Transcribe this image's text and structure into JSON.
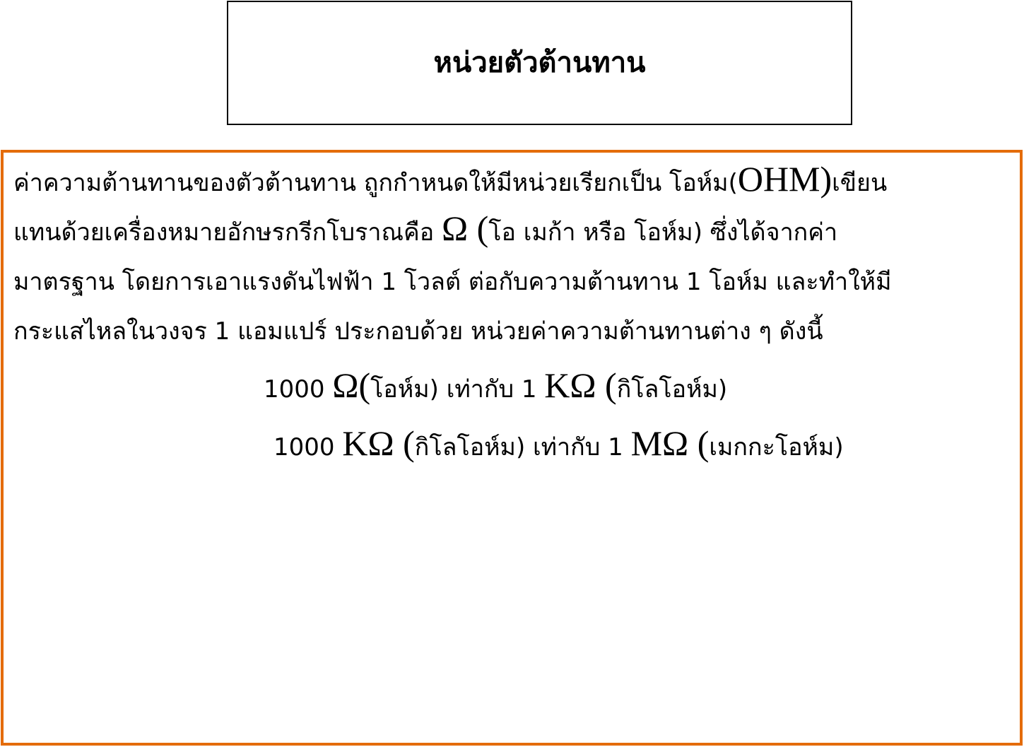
{
  "title": "หน่วยตัวต้านทาน",
  "colors": {
    "content_border": "#E46C0A",
    "title_border": "#000000"
  },
  "paragraph": {
    "l1_text": "ค่าความต้านทานของตัวต้านทาน ถูกกำหนดให้มีหน่วยเรียกเป็น โอห์ม(",
    "l1_sym": "OHM)",
    "l1_end": "เขียน",
    "l2_start": "แทนด้วยเครื่องหมายอักษรกรีกโบราณคือ ",
    "l2_sym": "Ω (",
    "l2_end": "โอ เมก้า หรือ โอห์ม) ซึ่งได้จากค่า",
    "l3": "มาตรฐาน โดยการเอาแรงดันไฟฟ้า 1 โวลต์ ต่อกับความต้านทาน 1 โอห์ม และทำให้มี",
    "l4": "กระแสไหลในวงจร 1 แอมแปร์ ประกอบด้วย หน่วยค่าความต้านทานต่าง ๆ ดังนี้"
  },
  "equations": [
    {
      "left_value": "1000  ",
      "left_unit": "Ω(",
      "left_name": "โอห์ม) เท่ากับ 1 ",
      "right_unit": "KΩ (",
      "right_name": "กิโลโอห์ม)"
    },
    {
      "left_value": "1000 ",
      "left_unit": "KΩ (",
      "left_name": "กิโลโอห์ม) เท่ากับ 1 ",
      "right_unit": "MΩ (",
      "right_name": "เมกกะโอห์ม)"
    }
  ]
}
